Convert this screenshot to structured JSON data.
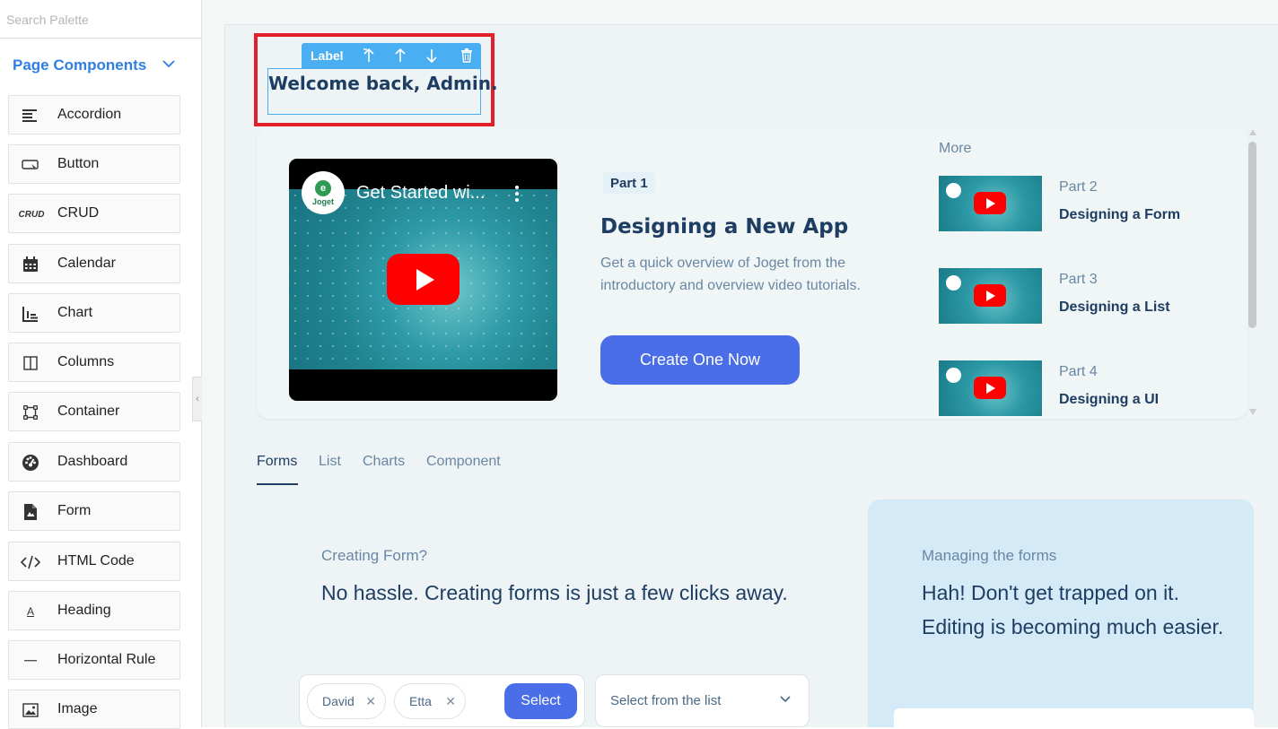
{
  "sidebar": {
    "search_placeholder": "Search Palette",
    "section_title": "Page Components",
    "items": [
      {
        "label": "Accordion",
        "icon": "accordion-icon"
      },
      {
        "label": "Button",
        "icon": "button-icon"
      },
      {
        "label": "CRUD",
        "icon": "crud-icon",
        "icon_text": "CRUD"
      },
      {
        "label": "Calendar",
        "icon": "calendar-icon"
      },
      {
        "label": "Chart",
        "icon": "chart-icon"
      },
      {
        "label": "Columns",
        "icon": "columns-icon"
      },
      {
        "label": "Container",
        "icon": "container-icon"
      },
      {
        "label": "Dashboard",
        "icon": "dashboard-icon"
      },
      {
        "label": "Form",
        "icon": "form-icon"
      },
      {
        "label": "HTML Code",
        "icon": "html-code-icon"
      },
      {
        "label": "Heading",
        "icon": "heading-icon",
        "icon_text": "A"
      },
      {
        "label": "Horizontal Rule",
        "icon": "horizontal-rule-icon"
      },
      {
        "label": "Image",
        "icon": "image-icon"
      }
    ]
  },
  "editor": {
    "toolbar_label": "Label",
    "selected_text": "Welcome back, Admin."
  },
  "video_card": {
    "video_title": "Get Started wi...",
    "logo_text": "Joget",
    "part": "Part 1",
    "title": "Designing a New App",
    "description": "Get a quick overview of  Joget from the introductory and overview video tutorials.",
    "cta": "Create One Now",
    "more_label": "More",
    "more_items": [
      {
        "part": "Part 2",
        "title": "Designing a Form"
      },
      {
        "part": "Part 3",
        "title": "Designing a List"
      },
      {
        "part": "Part 4",
        "title": "Designing a UI"
      }
    ]
  },
  "tabs": [
    "Forms",
    "List",
    "Charts",
    "Component"
  ],
  "active_tab": "Forms",
  "forms_section": {
    "subtitle": "Creating Form?",
    "heading": "No hassle. Creating forms is just a few clicks away.",
    "chips": [
      "David",
      "Etta"
    ],
    "select_button": "Select",
    "dropdown_placeholder": "Select from the list"
  },
  "managing_section": {
    "subtitle": "Managing the forms",
    "heading": "Hah! Don't get trapped on it. Editing is becoming much easier."
  },
  "colors": {
    "accent": "#2f7fe3",
    "selection": "#e41e26",
    "toolbar": "#49aef2",
    "primary_button": "#4a6ee8",
    "heading_text": "#1e3d62",
    "youtube_red": "#ff0000"
  }
}
